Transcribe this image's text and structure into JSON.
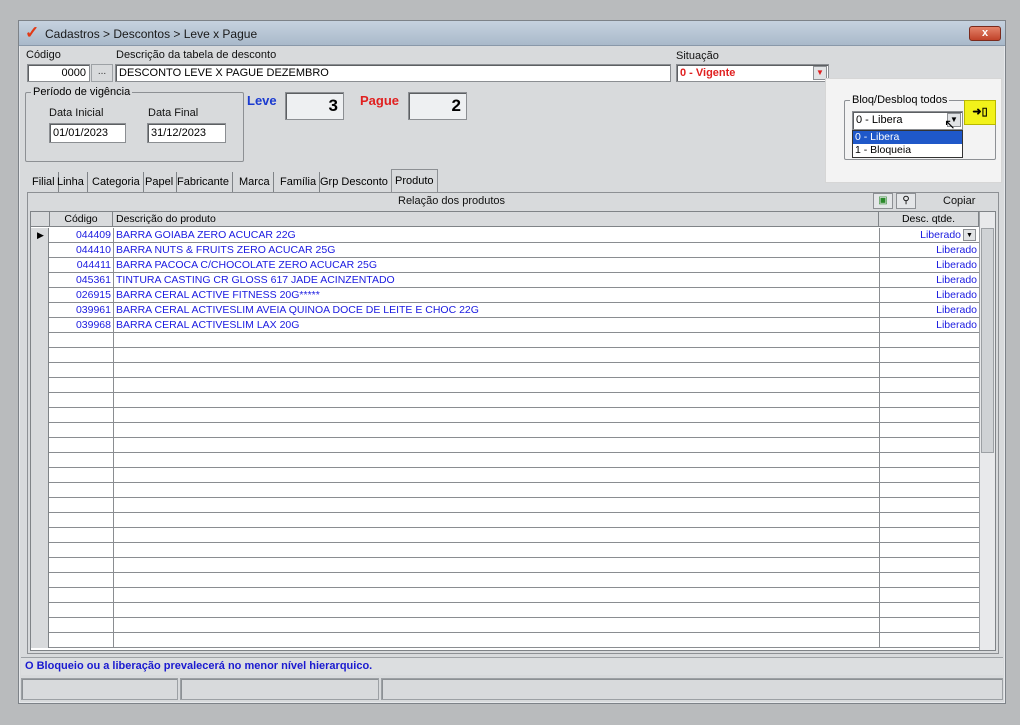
{
  "window": {
    "title": "Cadastros > Descontos > Leve x Pague",
    "close_label": "x"
  },
  "header": {
    "codigo_label": "Código",
    "codigo_value": "0000",
    "ellipsis": "...",
    "descricao_label": "Descrição da tabela de desconto",
    "descricao_value": "DESCONTO LEVE X PAGUE DEZEMBRO",
    "situacao_label": "Situação",
    "situacao_value": "0 - Vigente"
  },
  "periodo": {
    "title": "Período de vigência",
    "inicial_label": "Data Inicial",
    "inicial_value": "01/01/2023",
    "final_label": "Data Final",
    "final_value": "31/12/2023"
  },
  "leve": {
    "label": "Leve",
    "value": "3"
  },
  "pague": {
    "label": "Pague",
    "value": "2"
  },
  "bloq": {
    "title": "Bloq/Desbloq todos",
    "selected": "0 - Libera",
    "options": [
      "0 - Libera",
      "1 - Bloqueia"
    ],
    "apply_icon": "arrow-doc-icon"
  },
  "tabs": [
    "Filial",
    "Linha",
    "Categoria",
    "Papel",
    "Fabricante",
    "Marca",
    "Família",
    "Grp Desconto",
    "Produto"
  ],
  "panel": {
    "title": "Relação dos produtos",
    "copy_label": "Copiar",
    "columns": [
      "Código",
      "Descrição do produto",
      "Desc. qtde."
    ],
    "rows": [
      {
        "codigo": "044409",
        "descricao": "BARRA GOIABA ZERO ACUCAR 22G",
        "status": "Liberado"
      },
      {
        "codigo": "044410",
        "descricao": "BARRA NUTS & FRUITS ZERO ACUCAR 25G",
        "status": "Liberado"
      },
      {
        "codigo": "044411",
        "descricao": "BARRA PACOCA C/CHOCOLATE ZERO ACUCAR 25G",
        "status": "Liberado"
      },
      {
        "codigo": "045361",
        "descricao": "TINTURA CASTING CR GLOSS 617 JADE ACINZENTADO",
        "status": "Liberado"
      },
      {
        "codigo": "026915",
        "descricao": "BARRA CERAL ACTIVE FITNESS 20G*****",
        "status": "Liberado"
      },
      {
        "codigo": "039961",
        "descricao": "BARRA CERAL ACTIVESLIM AVEIA QUINOA DOCE DE LEITE E CHOC 22G",
        "status": "Liberado"
      },
      {
        "codigo": "039968",
        "descricao": "BARRA CERAL ACTIVESLIM LAX 20G",
        "status": "Liberado"
      }
    ]
  },
  "status_message": "O Bloqueio ou a liberação prevalecerá no menor nível hierarquico.",
  "colors": {
    "blue_text": "#1a1ae0",
    "red_text": "#e02020",
    "highlight": "#f2f21a",
    "selection": "#1f58c9"
  }
}
